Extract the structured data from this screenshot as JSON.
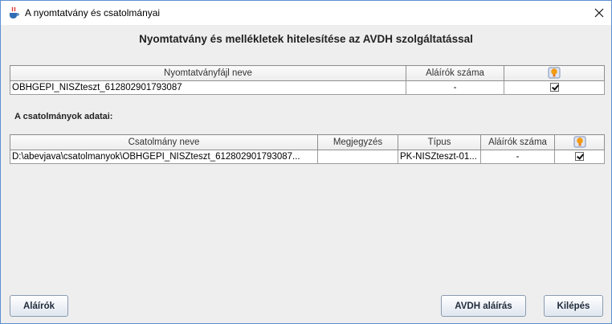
{
  "window": {
    "title": "A nyomtatvány és csatolmányai"
  },
  "heading": "Nyomtatvány és mellékletek hitelesítése az AVDH szolgáltatással",
  "form_table": {
    "columns": [
      "Nyomtatványfájl neve",
      "Aláírók száma"
    ],
    "rows": [
      {
        "filename": "OBHGEPI_NISZteszt_612802901793087",
        "signers": "-",
        "checked": true
      }
    ]
  },
  "attachments": {
    "label": "A csatolmányok adatai:",
    "columns": [
      "Csatolmány neve",
      "Megjegyzés",
      "Típus",
      "Aláírók száma"
    ],
    "rows": [
      {
        "name": "D:\\abevjava\\csatolmanyok\\OBHGEPI_NISZteszt_612802901793087...",
        "note": "",
        "type": "PK-NISZteszt-01...",
        "signers": "-",
        "checked": true
      }
    ]
  },
  "buttons": {
    "signers": "Aláírók",
    "avdh_sign": "AVDH aláírás",
    "exit": "Kilépés"
  },
  "icons": {
    "app": "java-cup-icon",
    "header": "help-bulb-icon",
    "close": "close-icon"
  }
}
